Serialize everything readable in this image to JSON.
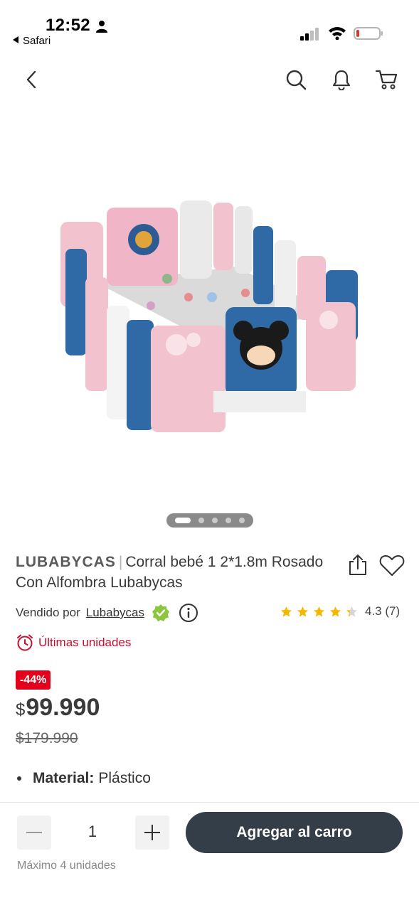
{
  "status": {
    "time": "12:52",
    "back_app": "Safari"
  },
  "nav": {
    "icons": [
      "back-icon",
      "search-icon",
      "bell-icon",
      "cart-icon"
    ]
  },
  "gallery": {
    "image_count": 5,
    "active_index": 0
  },
  "product": {
    "brand": "LUBABYCAS",
    "separator": "|",
    "name": "Corral bebé 1 2*1.8m Rosado Con Alfombra Lubabycas",
    "sold_by_label": "Vendido por",
    "seller": "Lubabycas",
    "rating": "4.3",
    "reviews": "(7)",
    "stars_value": 4.3,
    "stock_notice": "Últimas unidades",
    "discount": "-44%",
    "currency": "$",
    "price": "99.990",
    "old_price": "$179.990",
    "features": [
      {
        "key": "Material:",
        "value": "Plástico"
      }
    ]
  },
  "purchase": {
    "quantity": "1",
    "add_to_cart": "Agregar al carro",
    "max_note": "Máximo 4 unidades"
  },
  "colors": {
    "accent_red": "#c8102e",
    "discount_bg": "#e2001a",
    "cart_button": "#343e48",
    "star": "#f5b800",
    "verified": "#8cc63f"
  }
}
